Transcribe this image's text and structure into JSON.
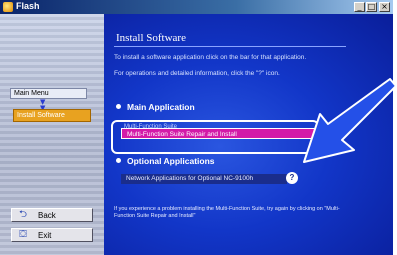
{
  "window": {
    "title": "Flash",
    "minimize": "_",
    "maximize": "□",
    "close": "×"
  },
  "sidebar": {
    "menu_label": "Main Menu",
    "menu_arrow": "▼\n▼",
    "active_item": "Install Software",
    "back_label": "Back",
    "exit_label": "Exit"
  },
  "main": {
    "heading": "Install Software",
    "line1": "To install a software application click on the bar for that application.",
    "line2": "For operations and detailed information, click the \"?\" icon.",
    "section1": "Main Application",
    "section1_sub": "Multi-Function Suite",
    "app_bar": "Multi-Function Suite Repair and Install",
    "section2": "Optional Applications",
    "opt_bar": "Network Applications for Optional NC-9100h",
    "help": "?",
    "footer": "If you experience a problem installing the Multi-Function Suite, try again by clicking on \"Multi-Function Suite Repair and Install\""
  },
  "colors": {
    "accent_bar": "#d31aa8",
    "menu_active": "#e8a220",
    "panel_blue": "#1236c8"
  }
}
